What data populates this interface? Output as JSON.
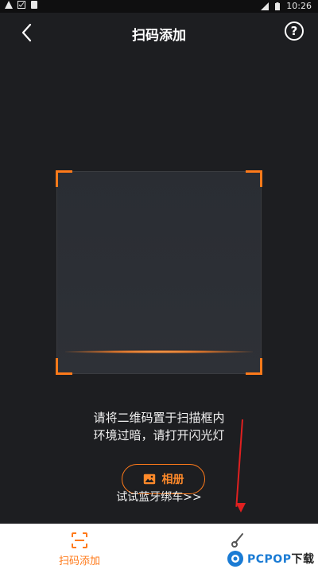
{
  "status_bar": {
    "time": "10:26"
  },
  "header": {
    "title": "扫码添加",
    "help_symbol": "?"
  },
  "scanner": {
    "hint_line1": "请将二维码置于扫描框内",
    "hint_line2": "环境过暗，请打开闪光灯"
  },
  "actions": {
    "album_label": "相册",
    "bluetooth_link": "试试蓝牙绑车>>"
  },
  "bottom_nav": {
    "items": [
      {
        "label": "扫码添加",
        "icon": "scan-icon",
        "active": true
      },
      {
        "label": "",
        "icon": "key-icon",
        "active": false
      }
    ]
  },
  "watermark": {
    "text_main": "PCPOP",
    "text_suffix": "下载"
  },
  "colors": {
    "accent": "#ff7a1a",
    "background": "#1d1e21",
    "annotation_arrow": "#e02020",
    "watermark_blue": "#1a7bd4"
  }
}
